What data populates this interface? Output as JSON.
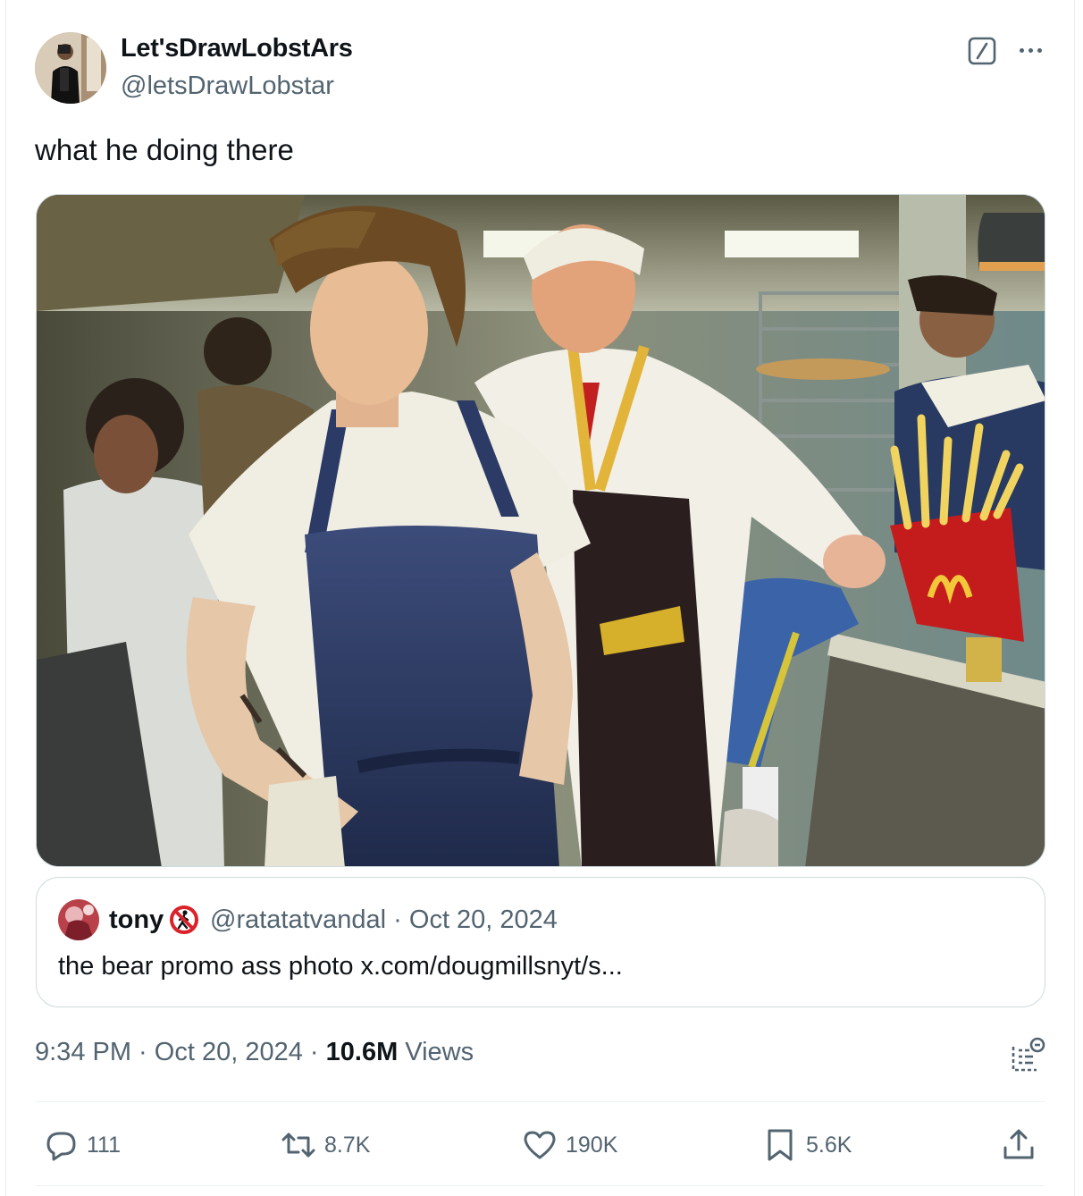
{
  "author": {
    "display_name": "Let'sDrawLobstArs",
    "handle": "@letsDrawLobstar"
  },
  "tweet": {
    "text": "what he doing there"
  },
  "quoted_tweet": {
    "display_name": "tony",
    "handle_date": "@ratatatvandal · Oct 20, 2024",
    "text": "the bear promo ass photo x.com/dougmillsnyt/s..."
  },
  "meta": {
    "time": "9:34 PM",
    "separator1": " · ",
    "date": "Oct 20, 2024",
    "separator2": " · ",
    "views_count": "10.6M",
    "views_label": " Views"
  },
  "actions": {
    "replies": "111",
    "reposts": "8.7K",
    "likes": "190K",
    "bookmarks": "5.6K"
  },
  "icons": {
    "grok": "grok-icon",
    "more": "more-icon",
    "reply": "reply-icon",
    "repost": "repost-icon",
    "like": "heart-icon",
    "bookmark": "bookmark-icon",
    "share": "share-icon",
    "analytics": "analytics-icon"
  },
  "colors": {
    "text": "#0f1419",
    "secondary": "#536471",
    "border": "#cfd9de"
  }
}
